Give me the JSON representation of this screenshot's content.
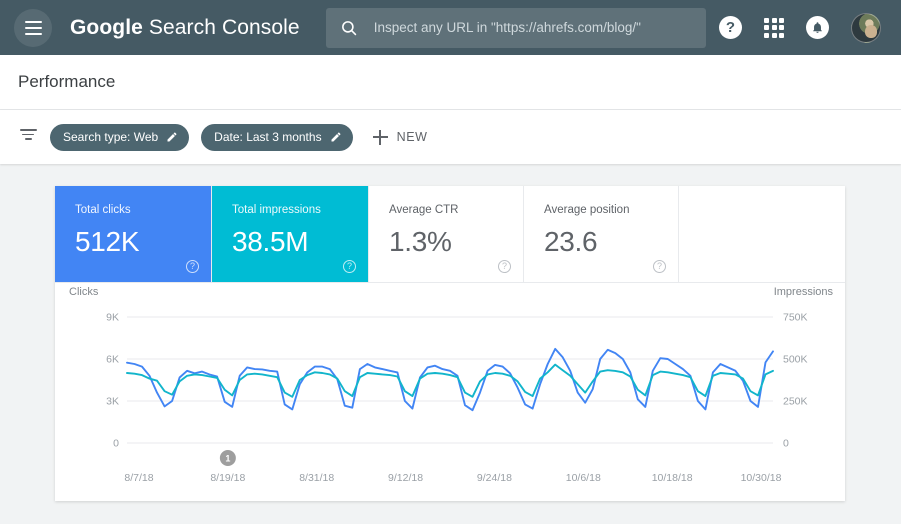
{
  "topbar": {
    "menu_icon": "hamburger-icon",
    "brand_bold": "Google",
    "brand_rest": " Search Console",
    "search": {
      "icon": "search-icon",
      "value": "",
      "placeholder": "Inspect any URL in \"https://ahrefs.com/blog/\""
    },
    "help_icon": "help-icon",
    "help_glyph": "?",
    "apps_icon": "apps-grid-icon",
    "notifications_icon": "bell-icon",
    "avatar": "user-avatar"
  },
  "page": {
    "title": "Performance"
  },
  "filterbar": {
    "filter_icon": "filter-icon",
    "chips": [
      {
        "label": "Search type: Web",
        "edit_icon": "pencil-icon"
      },
      {
        "label": "Date: Last 3 months",
        "edit_icon": "pencil-icon"
      }
    ],
    "new_label": "NEW",
    "plus_icon": "plus-icon"
  },
  "metrics": [
    {
      "label": "Total clicks",
      "value": "512K",
      "color": "#4285f4",
      "selected": true,
      "help": "?"
    },
    {
      "label": "Total impressions",
      "value": "38.5M",
      "color": "#00bcd4",
      "selected": true,
      "help": "?"
    },
    {
      "label": "Average CTR",
      "value": "1.3%",
      "color": "#ffffff",
      "selected": false,
      "help": "?"
    },
    {
      "label": "Average position",
      "value": "23.6",
      "color": "#ffffff",
      "selected": false,
      "help": "?"
    }
  ],
  "chart_data": {
    "type": "line",
    "title": "",
    "left_axis_label": "Clicks",
    "right_axis_label": "Impressions",
    "left_ticks": [
      "9K",
      "6K",
      "3K",
      "0"
    ],
    "right_ticks": [
      "750K",
      "500K",
      "250K",
      "0"
    ],
    "left_ylim": [
      0,
      9000
    ],
    "right_ylim": [
      0,
      750000
    ],
    "grid": true,
    "legend": "none",
    "x_tick_labels": [
      "8/7/18",
      "8/19/18",
      "8/31/18",
      "9/12/18",
      "9/24/18",
      "10/6/18",
      "10/18/18",
      "10/30/18"
    ],
    "annotations": [
      {
        "label": "1",
        "x_tick": "8/19/18"
      }
    ],
    "series": [
      {
        "name": "Impressions",
        "color": "#4285f4",
        "axis": "right",
        "values": [
          478,
          470,
          455,
          400,
          300,
          218,
          250,
          390,
          430,
          415,
          425,
          408,
          395,
          245,
          215,
          400,
          450,
          440,
          438,
          430,
          425,
          230,
          200,
          350,
          420,
          455,
          455,
          440,
          380,
          222,
          210,
          440,
          470,
          450,
          440,
          430,
          420,
          250,
          205,
          390,
          450,
          460,
          440,
          430,
          400,
          225,
          195,
          300,
          430,
          465,
          455,
          415,
          330,
          230,
          205,
          350,
          470,
          560,
          510,
          430,
          300,
          240,
          320,
          500,
          555,
          535,
          500,
          420,
          260,
          215,
          430,
          505,
          500,
          470,
          440,
          400,
          250,
          200,
          420,
          470,
          450,
          430,
          370,
          250,
          215,
          480,
          545
        ]
      },
      {
        "name": "Clicks",
        "color": "#12b5cb",
        "axis": "left",
        "values": [
          5000,
          4950,
          4850,
          4600,
          4450,
          3700,
          3450,
          4400,
          4800,
          4900,
          4850,
          4750,
          4650,
          3800,
          3400,
          4500,
          4900,
          4950,
          4900,
          4800,
          4700,
          3600,
          3300,
          4500,
          4850,
          5050,
          5000,
          4900,
          4600,
          3700,
          3350,
          4700,
          5000,
          4950,
          4900,
          4850,
          4750,
          3700,
          3350,
          4600,
          4950,
          5000,
          4950,
          4850,
          4700,
          3600,
          3300,
          4400,
          4900,
          5000,
          4950,
          4800,
          4400,
          3650,
          3350,
          4600,
          5050,
          5600,
          5200,
          4800,
          4200,
          3600,
          4400,
          5100,
          5200,
          5150,
          5050,
          4750,
          3800,
          3400,
          4850,
          5100,
          5050,
          4950,
          4850,
          4700,
          3700,
          3350,
          4800,
          5000,
          4950,
          4900,
          4600,
          3700,
          3400,
          4900,
          5150
        ]
      }
    ]
  }
}
